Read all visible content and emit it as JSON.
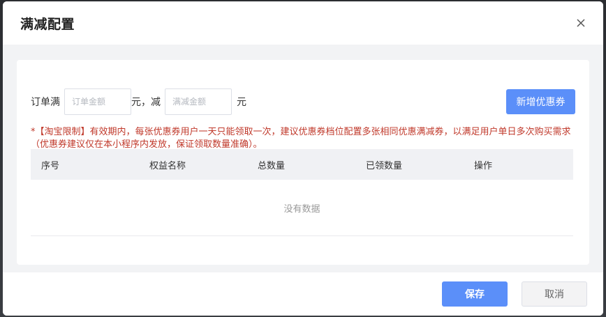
{
  "dialog": {
    "title": "满减配置",
    "close_icon": "close-icon"
  },
  "form": {
    "order_label": "订单满",
    "order_amount_placeholder": "订单金额",
    "order_amount_value": "",
    "unit_1": "元，减",
    "discount_amount_placeholder": "满减金额",
    "discount_amount_value": "",
    "unit_2": "元",
    "add_button_label": "新增优惠券"
  },
  "notice": "*【淘宝限制】有效期内，每张优惠券用户一天只能领取一次，建议优惠券档位配置多张相同优惠满减券，以满足用户单日多次购买需求（优惠券建议仅在本小程序内发放，保证领取数量准确）。",
  "table": {
    "columns": [
      "序号",
      "权益名称",
      "总数量",
      "已领数量",
      "操作"
    ],
    "rows": [],
    "empty_text": "没有数据"
  },
  "footer": {
    "save_label": "保存",
    "cancel_label": "取消"
  },
  "colors": {
    "primary": "#5b8ff9",
    "notice": "#c0392b"
  }
}
